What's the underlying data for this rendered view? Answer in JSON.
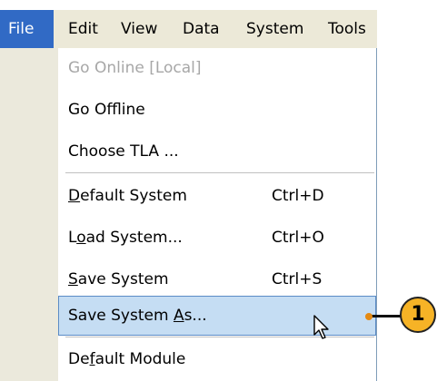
{
  "menubar": {
    "items": [
      "File",
      "Edit",
      "View",
      "Data",
      "System",
      "Tools"
    ]
  },
  "file_menu": {
    "go_online": "Go Online [Local]",
    "go_offline": "Go Offline",
    "choose_tla": "Choose TLA ...",
    "default_system": {
      "pre": "",
      "key": "D",
      "post": "efault System",
      "shortcut": "Ctrl+D"
    },
    "load_system": {
      "pre": "L",
      "key": "o",
      "post": "ad System...",
      "shortcut": "Ctrl+O"
    },
    "save_system": {
      "pre": "",
      "key": "S",
      "post": "ave System",
      "shortcut": "Ctrl+S"
    },
    "save_system_as": {
      "pre": "Save System ",
      "key": "A",
      "post": "s..."
    },
    "default_module": {
      "pre": "De",
      "key": "f",
      "post": "ault Module"
    }
  },
  "callout": {
    "number": "1"
  },
  "colors": {
    "menu_active": "#316ac5",
    "highlight": "#c5ddf3",
    "callout": "#f6b326"
  }
}
